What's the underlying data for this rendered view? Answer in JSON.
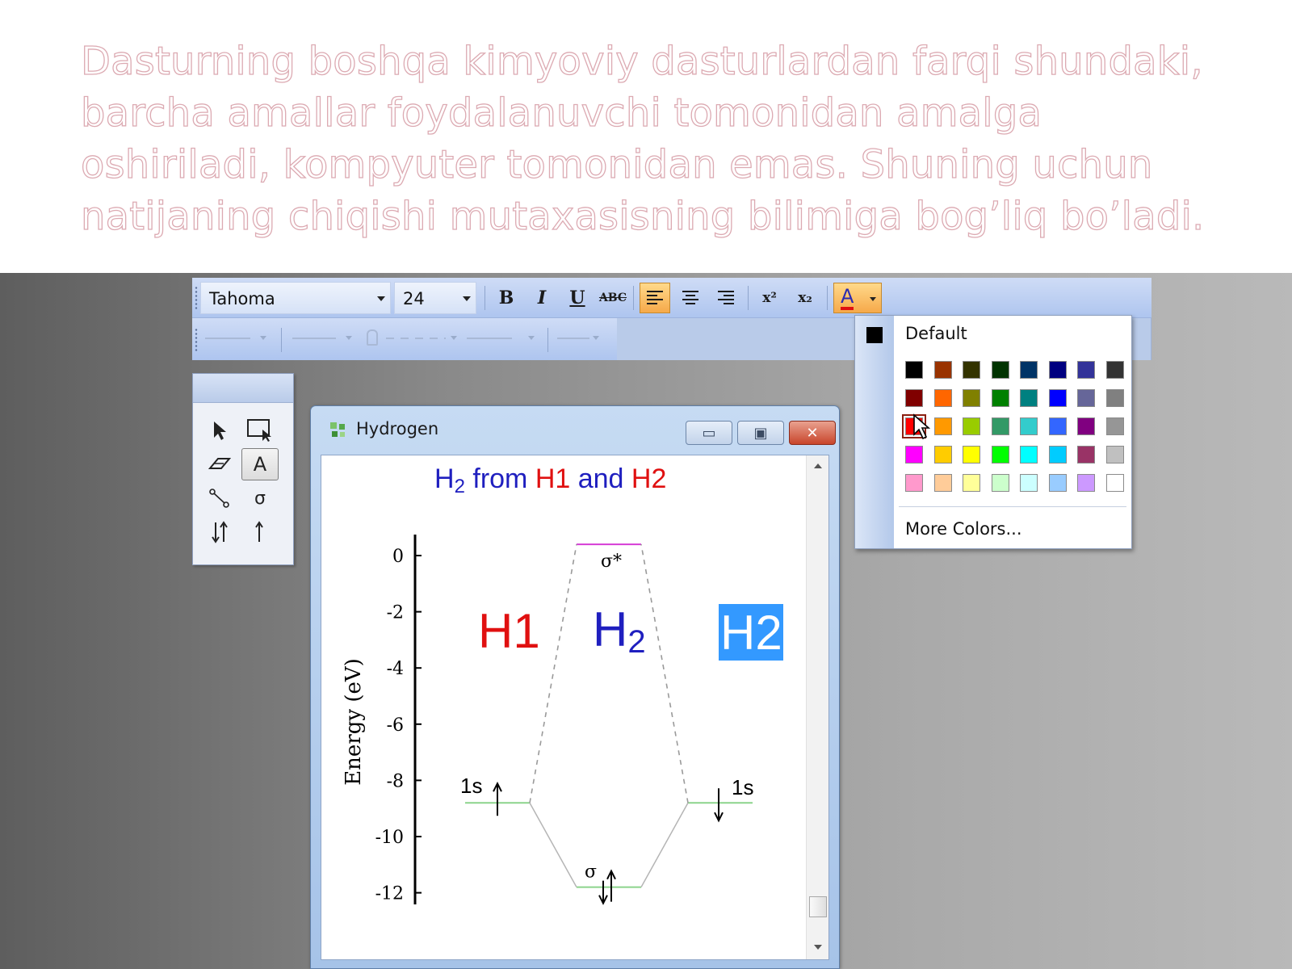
{
  "caption": {
    "text": "Dasturning boshqa kimyoviy dasturlardan farqi shundaki,\nbarcha amallar foydalanuvchi tomonidan amalga\noshiriladi, kompyuter tomonidan emas. Shuning uchun\nnatijaning  chiqishi mutaxasisning bilimiga bog’liq bo’ladi."
  },
  "toolbar": {
    "font_name": "Tahoma",
    "font_size": "24",
    "bold_label": "B",
    "italic_label": "I",
    "underline_label": "U",
    "strike_label": "ABC",
    "superscript_label": "x²",
    "subscript_label": "x₂",
    "font_color_label": "A",
    "font_color": "#e01010",
    "alignment_active": "left"
  },
  "palette": {
    "tools": [
      "pointer-tool",
      "marquee-tool",
      "eraser-tool",
      "text-tool",
      "line-tool",
      "sigma-tool",
      "paired-arrow-tool",
      "single-arrow-tool"
    ],
    "text_tool_label": "A",
    "sigma_label": "σ",
    "active_tool": "text-tool"
  },
  "window": {
    "title": "Hydrogen",
    "minimize_label": "▭",
    "maximize_label": "▣",
    "close_label": "✕"
  },
  "diagram": {
    "title_parts": [
      {
        "text": "H",
        "color": "#1f1fbf"
      },
      {
        "text": "2",
        "color": "#1f1fbf",
        "sub": true
      },
      {
        "text": " from ",
        "color": "#1f1fbf"
      },
      {
        "text": "H1",
        "color": "#e01010"
      },
      {
        "text": " and ",
        "color": "#1f1fbf"
      },
      {
        "text": "H2",
        "color": "#e01010"
      }
    ],
    "ylabel": "Energy (eV)",
    "yticks": [
      "0",
      "-2",
      "-4",
      "-6",
      "-8",
      "-10",
      "-12"
    ],
    "ytick_values": [
      0,
      -2,
      -4,
      -6,
      -8,
      -10,
      -12
    ],
    "left_atom_label": "H1",
    "molecule_label_main": "H",
    "molecule_label_sub": "2",
    "right_atom_label": "H2",
    "sigma_star_label": "σ*",
    "sigma_label": "σ",
    "left_level_label": "1s",
    "right_level_label": "1s",
    "levels": {
      "atomic_1s": -8.8,
      "sigma_star": 0.4,
      "sigma": -11.8
    },
    "colors": {
      "title_blue": "#1f1fbf",
      "red": "#e01010",
      "level_green": "#8bd48b",
      "sigma_star_magenta": "#d63cd6",
      "dash_gray": "#9a9a9a",
      "highlight_bg": "#3399ff"
    }
  },
  "color_menu": {
    "default_label": "Default",
    "more_label": "More Colors...",
    "selected": "#ff0000",
    "swatches": [
      [
        "#000000",
        "#993300",
        "#333300",
        "#003300",
        "#003366",
        "#000080",
        "#333399",
        "#333333"
      ],
      [
        "#800000",
        "#ff6600",
        "#808000",
        "#008000",
        "#008080",
        "#0000ff",
        "#666699",
        "#808080"
      ],
      [
        "#ff0000",
        "#ff9900",
        "#99cc00",
        "#339966",
        "#33cccc",
        "#3366ff",
        "#800080",
        "#969696"
      ],
      [
        "#ff00ff",
        "#ffcc00",
        "#ffff00",
        "#00ff00",
        "#00ffff",
        "#00ccff",
        "#993366",
        "#c0c0c0"
      ],
      [
        "#ff99cc",
        "#ffcc99",
        "#ffff99",
        "#ccffcc",
        "#ccffff",
        "#99ccff",
        "#cc99ff",
        "#ffffff"
      ]
    ]
  }
}
